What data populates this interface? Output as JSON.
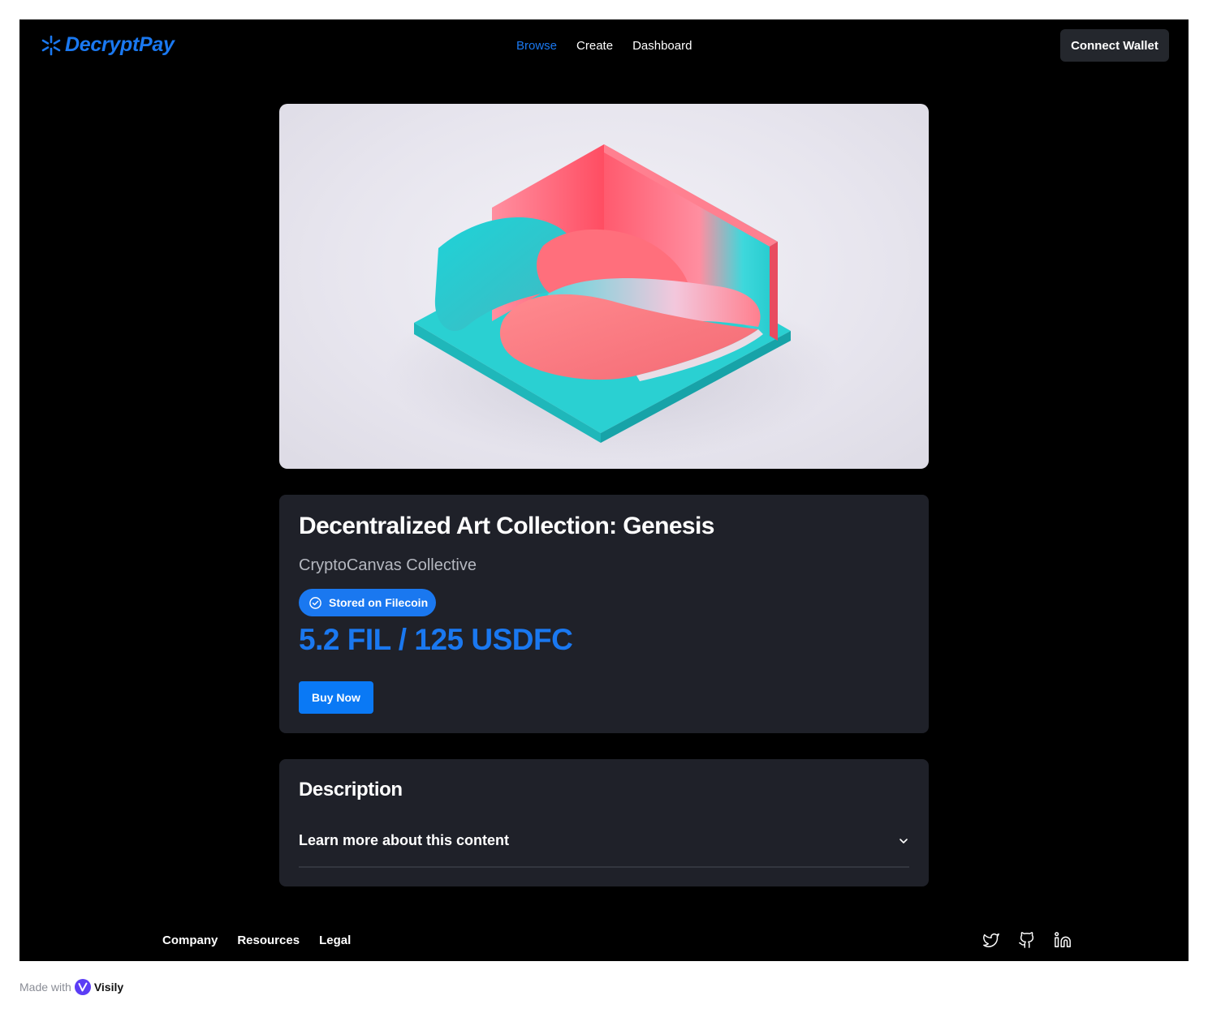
{
  "header": {
    "logo_text": "DecryptPay",
    "nav": [
      "Browse",
      "Create",
      "Dashboard"
    ],
    "active_nav": "Browse",
    "connect_label": "Connect Wallet"
  },
  "hero": {
    "alt": "Abstract 3D isometric sculpture"
  },
  "item": {
    "title": "Decentralized Art Collection: Genesis",
    "creator": "CryptoCanvas Collective",
    "badge": "Stored on Filecoin",
    "price": "5.2 FIL / 125 USDFC",
    "buy_label": "Buy Now"
  },
  "description": {
    "heading": "Description",
    "accordion_label": "Learn more about this content"
  },
  "footer": {
    "links": [
      "Company",
      "Resources",
      "Legal"
    ],
    "socials": [
      "twitter-icon",
      "github-icon",
      "linkedin-icon"
    ]
  },
  "made_with": {
    "prefix": "Made with",
    "brand": "Visily"
  },
  "colors": {
    "accent": "#1a78f0",
    "card": "#1f2129",
    "background": "#000000"
  }
}
